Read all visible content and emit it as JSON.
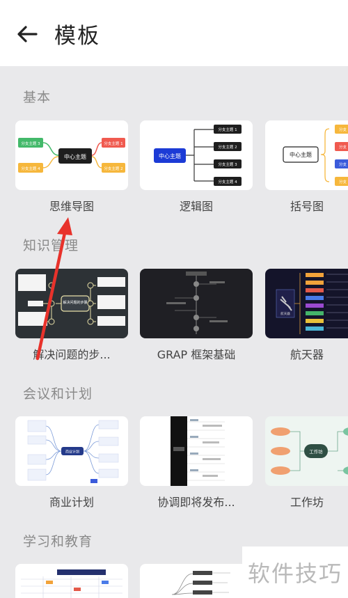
{
  "header": {
    "title": "模板"
  },
  "sections": [
    {
      "title": "基本"
    },
    {
      "title": "知识管理"
    },
    {
      "title": "会议和计划"
    },
    {
      "title": "学习和教育"
    }
  ],
  "cards": {
    "mindmap": {
      "label": "思维导图",
      "center": "中心主题",
      "left_top": "分支主题 3",
      "left_bottom": "分支主题 4",
      "right_top": "分支主题 1",
      "right_bottom": "分支主题 2"
    },
    "logic": {
      "label": "逻辑图",
      "center": "中心主题",
      "b1": "分支主题 1",
      "b2": "分支主题 2",
      "b3": "分支主题 3",
      "b4": "分支主题 4"
    },
    "brace": {
      "label": "括号图",
      "center": "中心主题",
      "b1": "分支",
      "b2": "分支",
      "b3": "分支",
      "b4": "分支"
    },
    "solve": {
      "label": "解决问题的步...",
      "center": "解决问题的步骤"
    },
    "grap": {
      "label": "GRAP 框架基础"
    },
    "spacecraft": {
      "label": "航天器",
      "center": "航天器"
    },
    "business": {
      "label": "商业计划",
      "center": "商业计划"
    },
    "release": {
      "label": "协调即将发布..."
    },
    "workshop": {
      "label": "工作坊",
      "center": "工作坊"
    }
  },
  "watermark": "软件技巧",
  "colors": {
    "accent_red": "#e8322b",
    "mindmap_blue_center": "#1e1e1e",
    "logic_blue": "#1c3bd6",
    "branch_green": "#43b96a",
    "branch_red": "#f05a4f",
    "branch_yellow": "#f6b73c",
    "branch_blue": "#3b5bdb"
  }
}
